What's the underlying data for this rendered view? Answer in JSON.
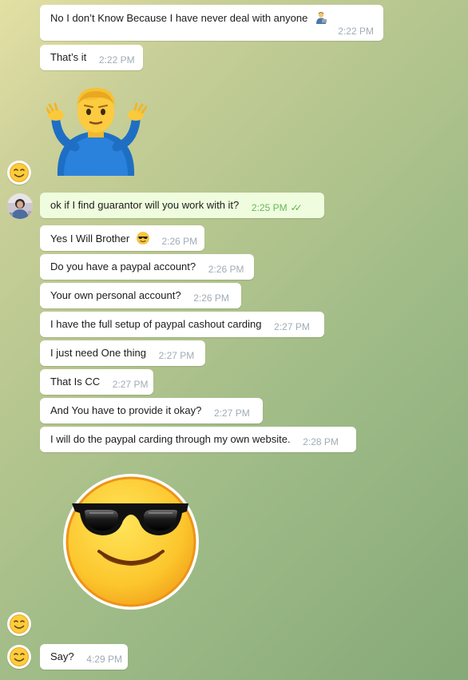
{
  "messages": [
    {
      "text": "No I don’t Know Because I have never deal with anyone",
      "time": "2:22 PM",
      "sender": "them",
      "emoji": "man-technologist-emoji"
    },
    {
      "text": "That’s it",
      "time": "2:22 PM",
      "sender": "them"
    },
    {
      "sticker": "man-shrugging-sticker",
      "sender": "them"
    },
    {
      "text": "ok if I find guarantor will you work with it?",
      "time": "2:25 PM",
      "sender": "me",
      "status": "read-double-check-icon"
    },
    {
      "text": "Yes I Will Brother",
      "time": "2:26 PM",
      "sender": "them",
      "emoji": "sunglasses-emoji"
    },
    {
      "text": "Do you have a paypal account?",
      "time": "2:26 PM",
      "sender": "them"
    },
    {
      "text": "Your own personal account?",
      "time": "2:26 PM",
      "sender": "them"
    },
    {
      "text": "I have the full setup of paypal cashout carding",
      "time": "2:27 PM",
      "sender": "them"
    },
    {
      "text": "I just need One thing",
      "time": "2:27 PM",
      "sender": "them"
    },
    {
      "text": "That Is CC",
      "time": "2:27 PM",
      "sender": "them"
    },
    {
      "text": "And You have to provide it okay?",
      "time": "2:27 PM",
      "sender": "them"
    },
    {
      "text": "I will do the paypal carding through my own website.",
      "time": "2:28 PM",
      "sender": "them"
    },
    {
      "sticker": "sunglasses-face-sticker",
      "sender": "them"
    },
    {
      "text": "Say?",
      "time": "4:29 PM",
      "sender": "them"
    }
  ],
  "icons": {
    "contact_avatar": "smiley-avatar-icon",
    "own_avatar": "profile-photo-avatar",
    "read_status": "double-check-icon"
  },
  "colors": {
    "incoming_bubble": "#ffffff",
    "outgoing_bubble": "#effdde",
    "time_text": "#a0acb6",
    "outgoing_time": "#6cb55e",
    "read_check": "#5fb34f"
  }
}
